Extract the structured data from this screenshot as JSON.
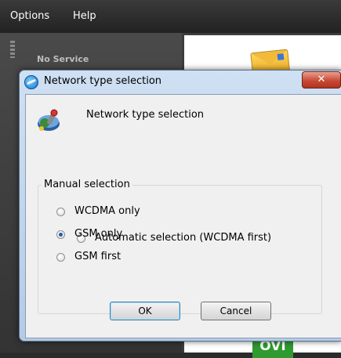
{
  "menubar": {
    "items": [
      "Options",
      "Help"
    ]
  },
  "status": {
    "text": "No Service"
  },
  "ovi": {
    "text": "OVI"
  },
  "dialog": {
    "title": "Network type selection",
    "close_label": "✕",
    "header_text": "Network type selection",
    "auto_option": {
      "label": "Automatic selection (WCDMA first)",
      "checked": false
    },
    "manual_group": {
      "legend": "Manual selection",
      "options": [
        {
          "label": "WCDMA only",
          "checked": false
        },
        {
          "label": "GSM only",
          "checked": true
        },
        {
          "label": "GSM first",
          "checked": false
        }
      ]
    },
    "ok_label": "OK",
    "cancel_label": "Cancel"
  },
  "colors": {
    "accent": "#1b5fb4",
    "close_button": "#c74a35",
    "titlebar": "#cfe0f3"
  }
}
